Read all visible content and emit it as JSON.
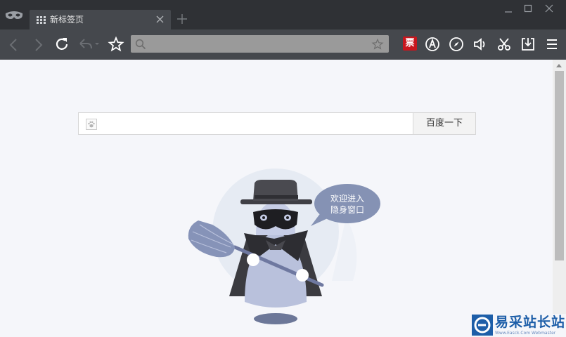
{
  "tab": {
    "title": "新标签页"
  },
  "omnibox": {
    "value": "",
    "placeholder": ""
  },
  "search": {
    "value": "",
    "button_label": "百度一下"
  },
  "mascot": {
    "bubble_line1": "欢迎进入",
    "bubble_line2": "隐身窗口"
  },
  "watermark": {
    "text": "易采站长站",
    "sub": "Www.Easck.Com Webmaster"
  },
  "toolbar": {
    "ticket_label": "票"
  },
  "colors": {
    "titlebar": "#2f3135",
    "toolbar": "#45484d",
    "content_bg": "#f5f6fa",
    "ticket": "#c8161d",
    "watermark": "#1d5ea8"
  },
  "icons": [
    "incognito-mask-icon",
    "apps-grid-icon",
    "close-icon",
    "plus-icon",
    "minimize-icon",
    "maximize-icon",
    "window-close-icon",
    "back-icon",
    "forward-icon",
    "reload-icon",
    "undo-icon",
    "star-icon",
    "search-icon",
    "ticket-icon",
    "ad-block-icon",
    "compass-icon",
    "speaker-icon",
    "scissors-icon",
    "download-icon",
    "menu-icon"
  ]
}
